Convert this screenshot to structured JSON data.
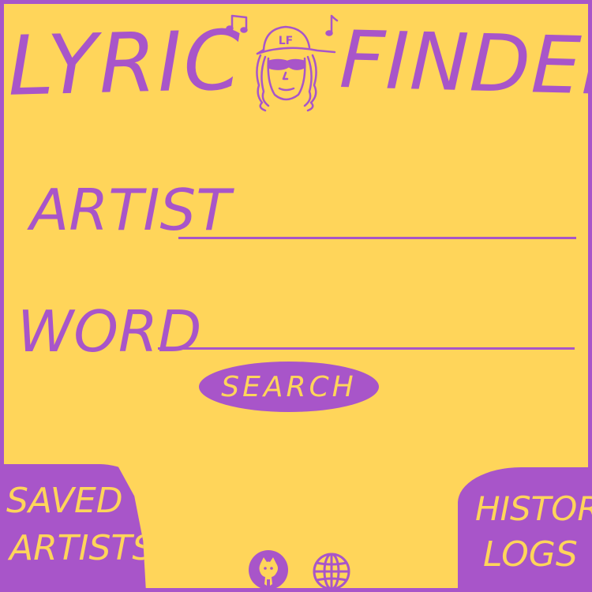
{
  "app": {
    "title_left": "LYRIC",
    "title_right": "FINDER",
    "logo_badge": "LF"
  },
  "form": {
    "artist_label": "ARTIST",
    "artist_value": "",
    "word_label": "WORD",
    "word_value": "",
    "search_label": "SEARCH"
  },
  "corners": {
    "saved_artists": [
      "SAVED",
      "ARTISTS"
    ],
    "history_logs": [
      "HISTORY",
      "LOGS"
    ]
  },
  "footer": {
    "icons": [
      "github-icon",
      "globe-icon"
    ]
  },
  "colors": {
    "background": "#ffd55a",
    "accent": "#a855c9"
  }
}
